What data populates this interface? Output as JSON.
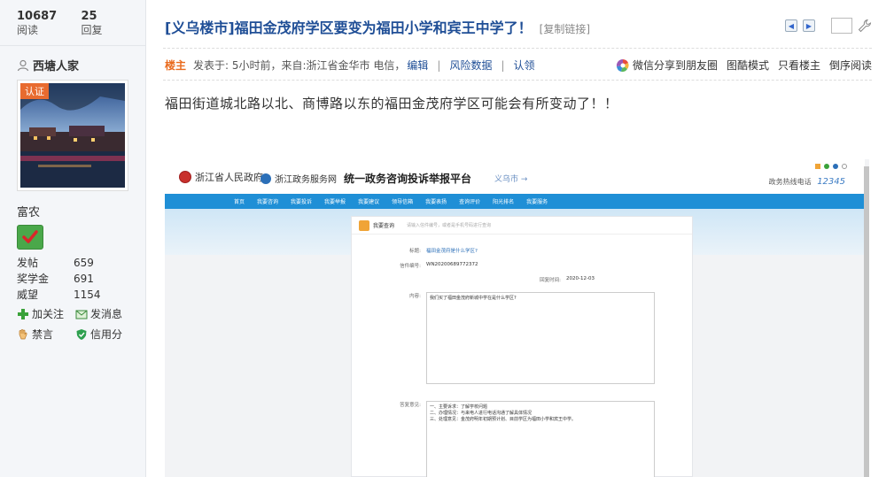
{
  "stats": [
    {
      "value": "10687",
      "label": "阅读"
    },
    {
      "value": "25",
      "label": "回复"
    }
  ],
  "author": {
    "name": "西塘人家",
    "badge": "认证",
    "rank": "富农",
    "fields": [
      {
        "key": "发帖",
        "value": "659"
      },
      {
        "key": "奖学金",
        "value": "691"
      },
      {
        "key": "威望",
        "value": "1154"
      }
    ],
    "actions_row1": [
      {
        "label": "加关注",
        "icon": "plus-icon"
      },
      {
        "label": "发消息",
        "icon": "message-icon"
      }
    ],
    "actions_row2": [
      {
        "label": "禁言",
        "icon": "hand-icon"
      },
      {
        "label": "信用分",
        "icon": "shield-icon"
      }
    ]
  },
  "post": {
    "title": "[义乌楼市]福田金茂府学区要变为福田小学和宾王中学了！",
    "copy_link": "[复制链接]",
    "owner_label": "楼主",
    "meta": "发表于: 5小时前，来自:浙江省金华市 电信，",
    "edit": "编辑",
    "risk": "风险数据",
    "claim": "认领",
    "share": "微信分享到朋友圈",
    "view_mode": "图酷模式",
    "only_owner": "只看楼主",
    "reverse": "倒序阅读",
    "sep": "|",
    "body": "福田街道城北路以北、商博路以东的福田金茂府学区可能会有所变动了！！"
  },
  "screenshot": {
    "gov_name": "浙江省人民政府",
    "zw_name": "浙江政务服务网",
    "platform": "统一政务咨询投诉举报平台",
    "city": "义乌市 →",
    "hotline_label": "政务热线电话",
    "hotline_number": "12345",
    "nav": [
      "首页",
      "我要咨询",
      "我要投诉",
      "我要举报",
      "我要建议",
      "领导信箱",
      "我要表扬",
      "查询评价",
      "阳光排名",
      "我要服务"
    ],
    "card_title": "我要查询",
    "card_note": "请输入信件编号，或者是手机号码进行查询",
    "rows": {
      "title_label": "标题:",
      "title_value": "福田金茂府是什么学区?",
      "code_label": "信件编号:",
      "code_value": "WN20200689772372",
      "time_label": "回复时间:",
      "time_value": "2020-12-03",
      "content_label": "内容:",
      "content_value": "我们买了福田金茂府新城中学在是什么学区?",
      "reply_label": "答复意见:",
      "reply_value": "一、主要诉求：了解学校问题\n二、办理情况：与来电人进行电话沟通了解具体情况\n三、处理意见：金茂府明年初期预计划、目前学区为福田小学和宾王中学。"
    }
  }
}
